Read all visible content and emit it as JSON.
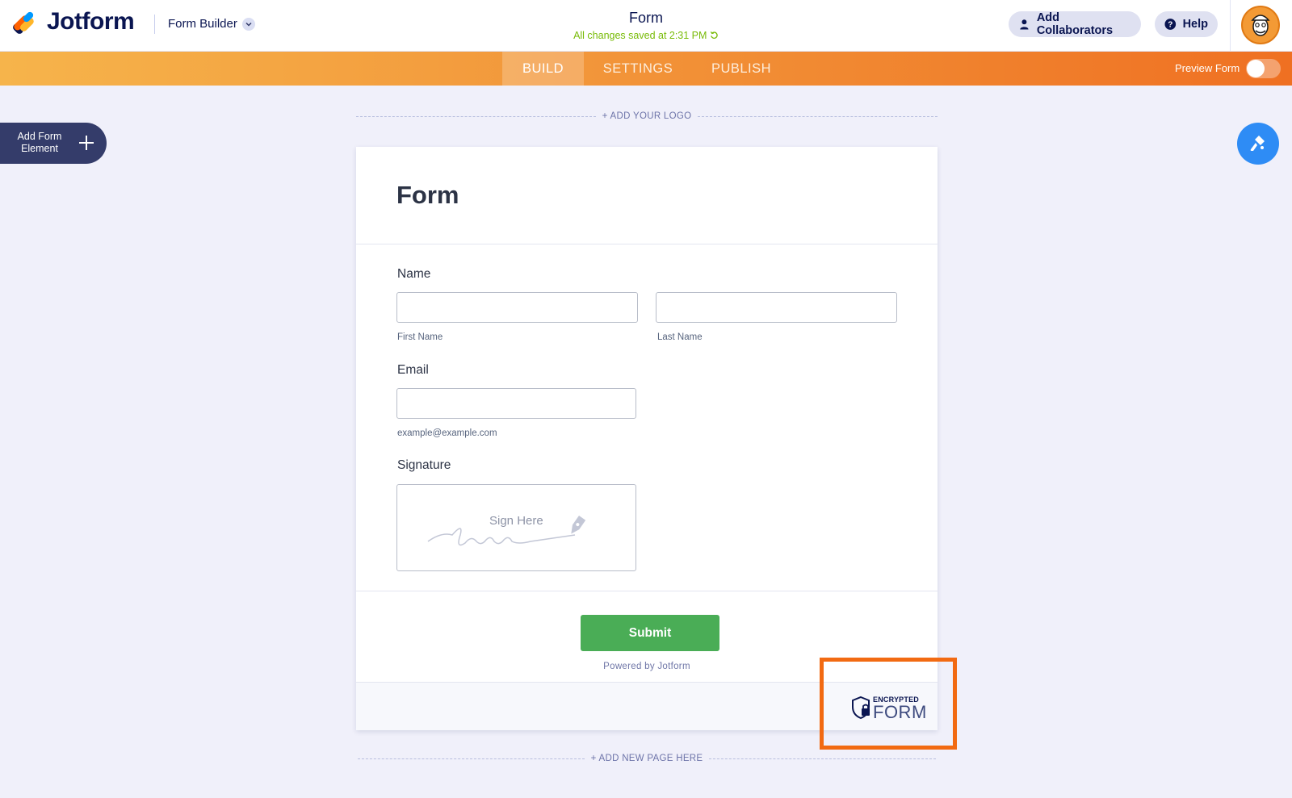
{
  "header": {
    "brand": "Jotform",
    "mode_label": "Form Builder",
    "form_title": "Form",
    "save_status": "All changes saved at 2:31 PM",
    "add_collaborators": "Add Collaborators",
    "help": "Help"
  },
  "nav": {
    "tabs": [
      "BUILD",
      "SETTINGS",
      "PUBLISH"
    ],
    "active_tab": "BUILD",
    "preview_label": "Preview Form",
    "preview_enabled": false
  },
  "sidebar": {
    "add_element_label": "Add Form Element"
  },
  "canvas": {
    "add_logo": "+ ADD YOUR LOGO",
    "add_page": "+ ADD NEW PAGE HERE"
  },
  "form": {
    "title": "Form",
    "name_label": "Name",
    "first_name_sublabel": "First Name",
    "last_name_sublabel": "Last Name",
    "email_label": "Email",
    "email_sublabel": "example@example.com",
    "signature_label": "Signature",
    "signature_placeholder": "Sign Here",
    "submit": "Submit",
    "powered_by": "Powered by Jotform",
    "encrypted_top": "ENCRYPTED",
    "encrypted_bottom": "FORM"
  },
  "colors": {
    "accent_orange": "#ef7022",
    "submit_green": "#4aad56",
    "save_green": "#78bb07",
    "highlight": "#f26a12",
    "designer_blue": "#2e8cf5"
  }
}
